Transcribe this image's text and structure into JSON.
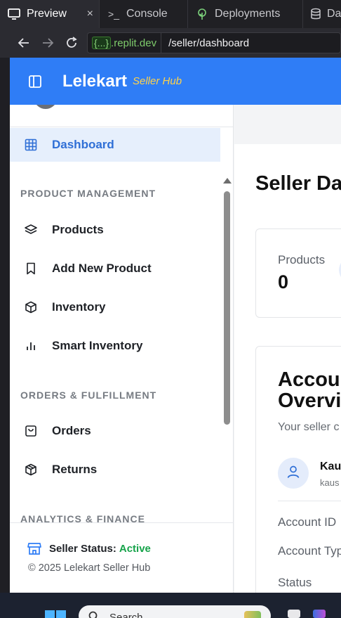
{
  "browser": {
    "tabs": [
      {
        "label": "Preview",
        "icon": "preview-icon",
        "active": true,
        "close": "×"
      },
      {
        "label": "Console",
        "icon": "console-icon",
        "active": false
      },
      {
        "label": "Deployments",
        "icon": "deployments-icon",
        "active": false
      },
      {
        "label": "Da",
        "icon": "database-icon",
        "active": false
      }
    ],
    "console_prompt": ">_",
    "url": {
      "domain_badge": "{...}",
      "domain": ".replit.dev",
      "path": "/seller/dashboard"
    }
  },
  "app": {
    "brand": "Lelekart",
    "brand_sub": "Seller Hub",
    "accent": "#2f7df6",
    "brand_sub_color": "#ffd24a"
  },
  "sidebar": {
    "dashboard": "Dashboard",
    "sections": [
      {
        "title": "PRODUCT MANAGEMENT",
        "items": [
          "Products",
          "Add New Product",
          "Inventory",
          "Smart Inventory"
        ]
      },
      {
        "title": "ORDERS & FULFILLMENT",
        "items": [
          "Orders",
          "Returns"
        ]
      },
      {
        "title": "ANALYTICS & FINANCE",
        "items": []
      }
    ],
    "footer": {
      "status_label": "Seller Status:",
      "status_value": "Active",
      "status_color": "#16a34a",
      "copyright": "© 2025 Lelekart Seller Hub"
    }
  },
  "main": {
    "title": "Seller Da",
    "stat_card": {
      "label": "Products",
      "value": "0"
    },
    "account": {
      "heading_line1": "Accoun",
      "heading_line2": "Overvie",
      "desc": "Your seller c status",
      "name": "Kau",
      "email": "kaus",
      "rows": [
        "Account ID",
        "Account Typ",
        "Status"
      ]
    }
  },
  "taskbar": {
    "search_placeholder": "Search"
  }
}
